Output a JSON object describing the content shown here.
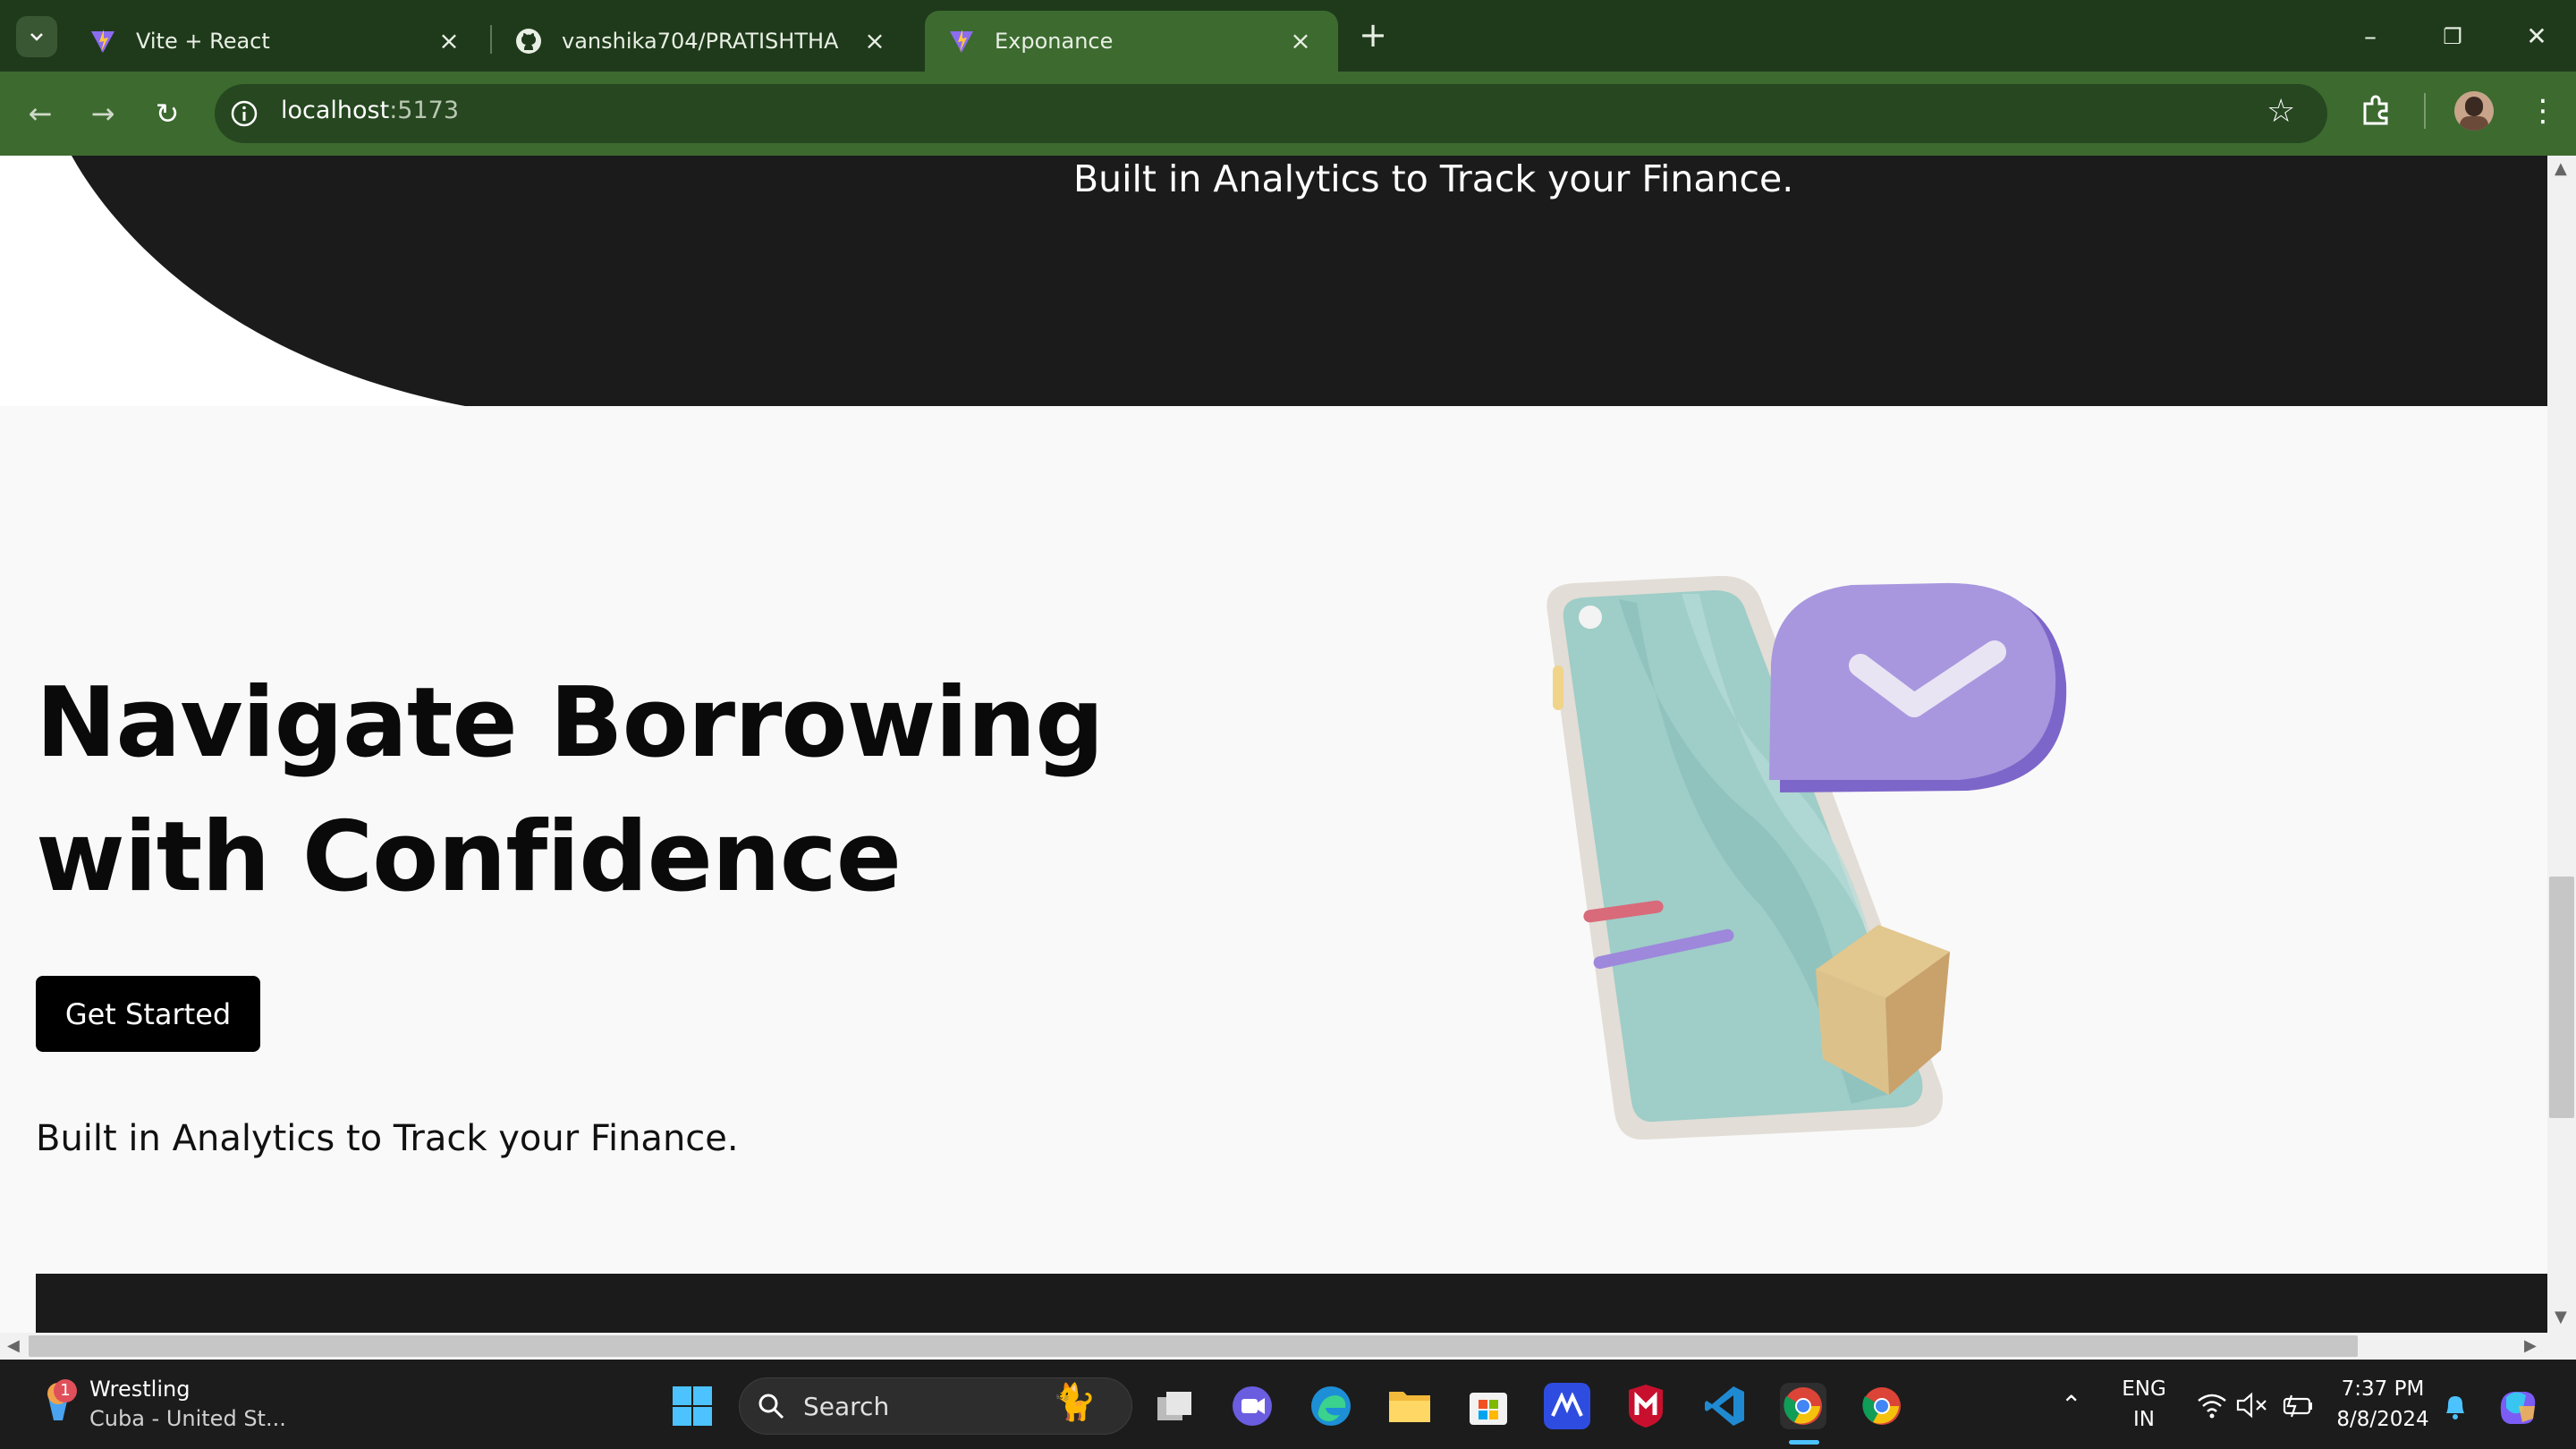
{
  "browser": {
    "tabs": [
      {
        "title": "Vite + React",
        "icon": "vite-icon",
        "active": false
      },
      {
        "title": "vanshika704/PRATISHTHA",
        "icon": "github-icon",
        "active": false
      },
      {
        "title": "Exponance",
        "icon": "vite-icon",
        "active": true
      }
    ],
    "url_host": "localhost",
    "url_port": ":5173"
  },
  "page": {
    "top_tagline": "Built in Analytics to Track your Finance.",
    "heading": "Navigate Borrowing with Confidence",
    "cta_label": "Get Started",
    "tagline": "Built in Analytics to Track your Finance."
  },
  "taskbar": {
    "weather_title": "Wrestling",
    "weather_sub": "Cuba - United St...",
    "weather_badge": "1",
    "search_label": "Search",
    "lang_line1": "ENG",
    "lang_line2": "IN",
    "time": "7:37 PM",
    "date": "8/8/2024"
  },
  "colors": {
    "tab_bar": "#1f3a1b",
    "toolbar": "#3c6a2f",
    "dark_band": "#1b1b1b",
    "cta_bg": "#000000",
    "page_bg": "#f9f9f9"
  }
}
